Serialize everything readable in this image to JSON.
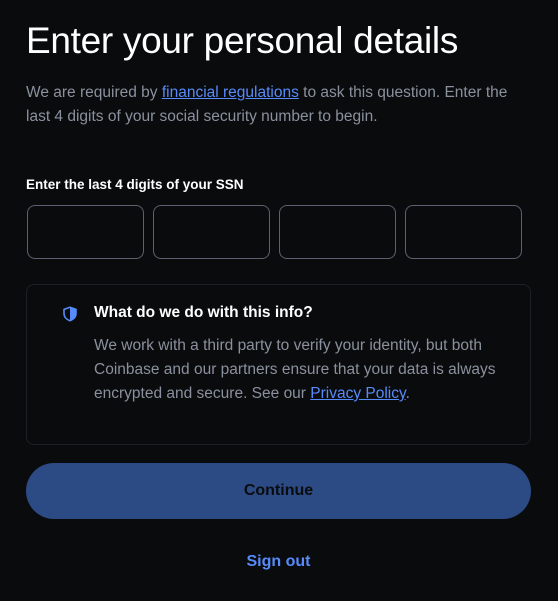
{
  "page": {
    "title": "Enter your personal details",
    "intro_before": "We are required by ",
    "intro_link": "financial regulations",
    "intro_after": " to ask this question. Enter the last 4 digits of your social security number to begin."
  },
  "ssn": {
    "label": "Enter the last 4 digits of your SSN",
    "digits": [
      "",
      "",
      "",
      ""
    ]
  },
  "info": {
    "icon": "shield-icon",
    "heading": "What do we do with this info?",
    "body": "We work with a third party to verify your identity, but both Coinbase and our partners ensure that your data is always encrypted and secure. See our ",
    "link": "Privacy Policy",
    "body_end": "."
  },
  "actions": {
    "continue_label": "Continue",
    "signout_label": "Sign out"
  },
  "colors": {
    "background": "#0a0b0d",
    "link": "#578bfa",
    "continue_bg": "#2c4b84",
    "muted_text": "#8a919e"
  }
}
